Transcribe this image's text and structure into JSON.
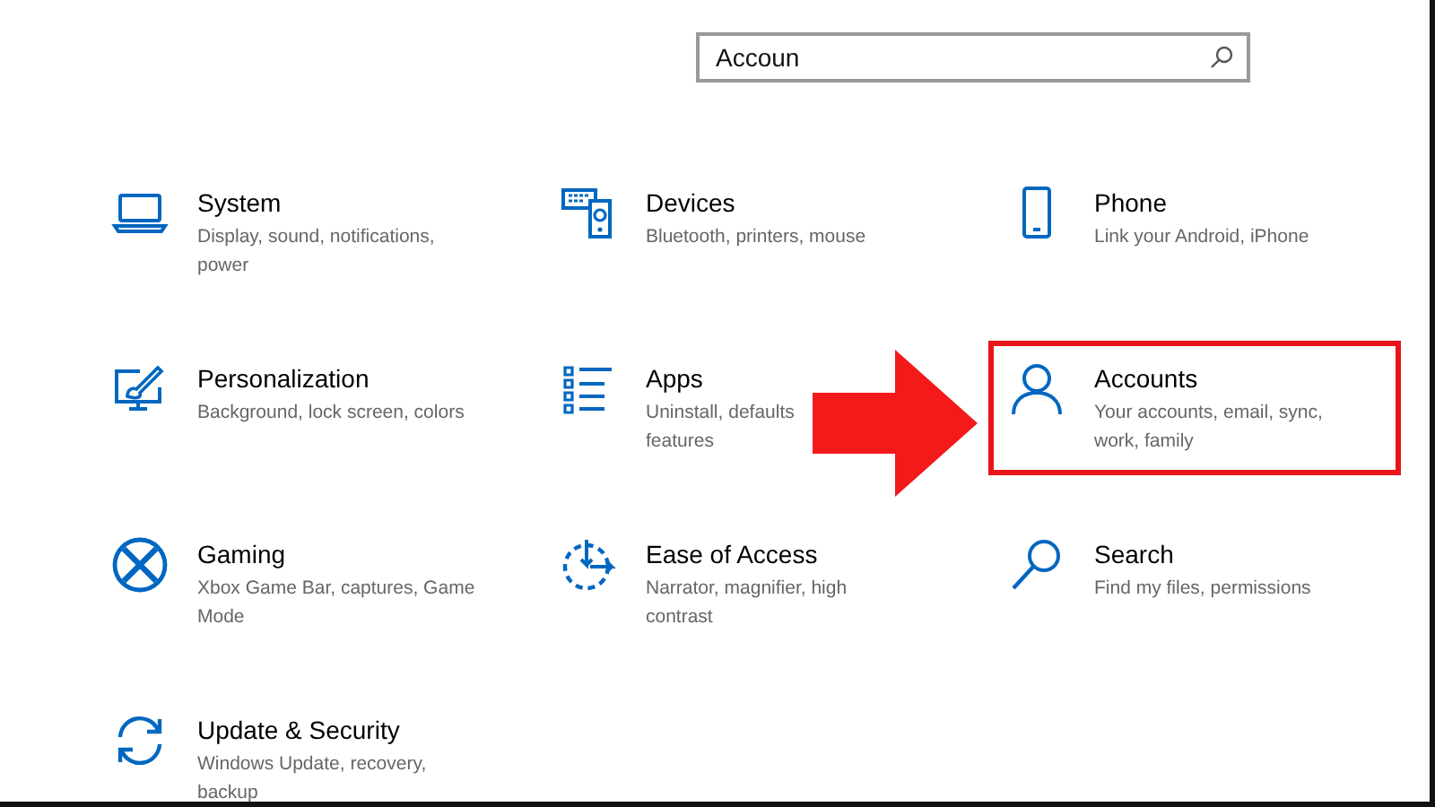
{
  "search": {
    "value": "Accoun"
  },
  "items": [
    {
      "title": "System",
      "description": [
        "Display, sound, notifications,",
        "power"
      ],
      "highlighted": false
    },
    {
      "title": "Devices",
      "description": [
        "Bluetooth, printers, mouse"
      ],
      "highlighted": false
    },
    {
      "title": "Phone",
      "description": [
        "Link your Android, iPhone"
      ],
      "highlighted": false
    },
    {
      "title": "Personalization",
      "description": [
        "Background, lock screen, colors"
      ],
      "highlighted": false
    },
    {
      "title": "Apps",
      "description": [
        "Uninstall, defaults",
        "features"
      ],
      "highlighted": false
    },
    {
      "title": "Accounts",
      "description": [
        "Your accounts, email, sync,",
        "work, family"
      ],
      "highlighted": true
    },
    {
      "title": "Gaming",
      "description": [
        "Xbox Game Bar, captures, Game",
        "Mode"
      ],
      "highlighted": false
    },
    {
      "title": "Ease of Access",
      "description": [
        "Narrator, magnifier, high",
        "contrast"
      ],
      "highlighted": false
    },
    {
      "title": "Search",
      "description": [
        "Find my files, permissions"
      ],
      "highlighted": false
    },
    {
      "title": "Update & Security",
      "description": [
        "Windows Update, recovery,",
        "backup"
      ],
      "highlighted": false
    }
  ]
}
